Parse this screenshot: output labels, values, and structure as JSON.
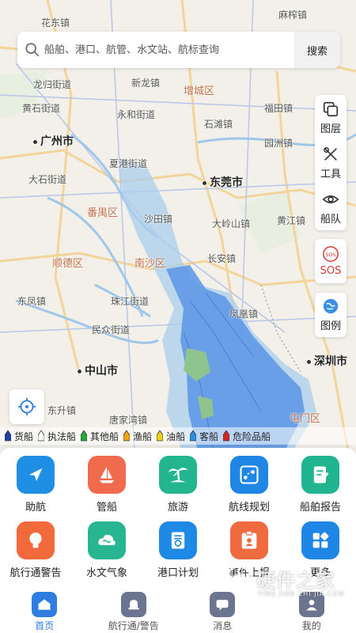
{
  "search": {
    "placeholder": "船舶、港口、航管、水文站、航标查询",
    "button": "搜索"
  },
  "tools": {
    "layers": "图层",
    "tools": "工具",
    "fleet": "船队",
    "sos": "SOS",
    "legend": "图例"
  },
  "map_labels": [
    {
      "text": "花东镇",
      "type": "town"
    },
    {
      "text": "麻榨镇",
      "type": "town"
    },
    {
      "text": "龙归街道",
      "type": "town"
    },
    {
      "text": "新龙镇",
      "type": "town"
    },
    {
      "text": "增城区",
      "type": "district"
    },
    {
      "text": "黄石街道",
      "type": "town"
    },
    {
      "text": "永和街道",
      "type": "town"
    },
    {
      "text": "福田镇",
      "type": "town"
    },
    {
      "text": "广州市",
      "type": "city"
    },
    {
      "text": "石滩镇",
      "type": "town"
    },
    {
      "text": "夏港街道",
      "type": "town"
    },
    {
      "text": "园洲镇",
      "type": "town"
    },
    {
      "text": "大石街道",
      "type": "town"
    },
    {
      "text": "东莞市",
      "type": "city"
    },
    {
      "text": "番禺区",
      "type": "district"
    },
    {
      "text": "沙田镇",
      "type": "town"
    },
    {
      "text": "大岭山镇",
      "type": "town"
    },
    {
      "text": "黄江镇",
      "type": "town"
    },
    {
      "text": "顺德区",
      "type": "district"
    },
    {
      "text": "南沙区",
      "type": "district"
    },
    {
      "text": "长安镇",
      "type": "town"
    },
    {
      "text": "东凤镇",
      "type": "town"
    },
    {
      "text": "珠江街道",
      "type": "town"
    },
    {
      "text": "凤凰镇",
      "type": "town"
    },
    {
      "text": "民众街道",
      "type": "town"
    },
    {
      "text": "中山市",
      "type": "city"
    },
    {
      "text": "深圳市",
      "type": "city"
    },
    {
      "text": "东升镇",
      "type": "town"
    },
    {
      "text": "唐家湾镇",
      "type": "town"
    },
    {
      "text": "屯门区",
      "type": "district"
    }
  ],
  "legend": [
    {
      "label": "货船",
      "color": "#1f3fa8"
    },
    {
      "label": "执法船",
      "color": "#ffffff"
    },
    {
      "label": "其他船",
      "color": "#27a83c"
    },
    {
      "label": "渔船",
      "color": "#f2a51a"
    },
    {
      "label": "油船",
      "color": "#e8d21a"
    },
    {
      "label": "客船",
      "color": "#2a8fe0"
    },
    {
      "label": "危险品船",
      "color": "#d0281f"
    }
  ],
  "functions": [
    {
      "label": "助航",
      "color": "#1f8fe6",
      "icon": "navigation-icon"
    },
    {
      "label": "管船",
      "color": "#f06a4e",
      "icon": "sailboat-icon"
    },
    {
      "label": "旅游",
      "color": "#23b58f",
      "icon": "palm-island-icon"
    },
    {
      "label": "航线规划",
      "color": "#1f86e6",
      "icon": "route-plan-icon"
    },
    {
      "label": "船舶报告",
      "color": "#20b490",
      "icon": "report-icon"
    },
    {
      "label": "航行通警告",
      "color": "#f26a3c",
      "icon": "bulb-alert-icon"
    },
    {
      "label": "水文气象",
      "color": "#28b592",
      "icon": "weather-icon"
    },
    {
      "label": "港口计划",
      "color": "#1f8ae6",
      "icon": "port-plan-icon"
    },
    {
      "label": "事件上报",
      "color": "#ef6a3e",
      "icon": "event-report-icon"
    },
    {
      "label": "更多",
      "color": "#1f86e6",
      "icon": "more-grid-icon"
    }
  ],
  "nav": [
    {
      "label": "首页",
      "active": true
    },
    {
      "label": "航行通/警告",
      "active": false
    },
    {
      "label": "消息",
      "active": false
    },
    {
      "label": "我的",
      "active": false
    }
  ],
  "watermark": {
    "main": "硬件之家",
    "sub": "YING JIAN ZHI JIA.COM"
  }
}
